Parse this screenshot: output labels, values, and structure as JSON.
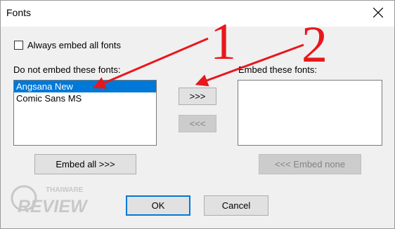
{
  "window": {
    "title": "Fonts",
    "close_icon": "close-icon"
  },
  "options": {
    "always_embed_label": "Always embed all fonts",
    "always_embed_checked": false
  },
  "left_list": {
    "label": "Do not embed these fonts:",
    "items": [
      {
        "label": "Angsana New",
        "selected": true
      },
      {
        "label": "Comic Sans MS",
        "selected": false
      }
    ]
  },
  "right_list": {
    "label": "Embed these fonts:",
    "items": []
  },
  "buttons": {
    "add": ">>>",
    "remove": "<<<",
    "embed_all": "Embed all  >>>",
    "embed_none": "<<<  Embed none",
    "ok": "OK",
    "cancel": "Cancel"
  },
  "annotations": {
    "marker_1": "1",
    "marker_2": "2",
    "color": "#e8171c"
  },
  "watermark": {
    "line1": "THAIWARE",
    "line2": "REVIEW",
    "color": "#c4c4c4"
  },
  "colors": {
    "selection": "#0078d7",
    "dialog_bg": "#f0f0f0"
  }
}
